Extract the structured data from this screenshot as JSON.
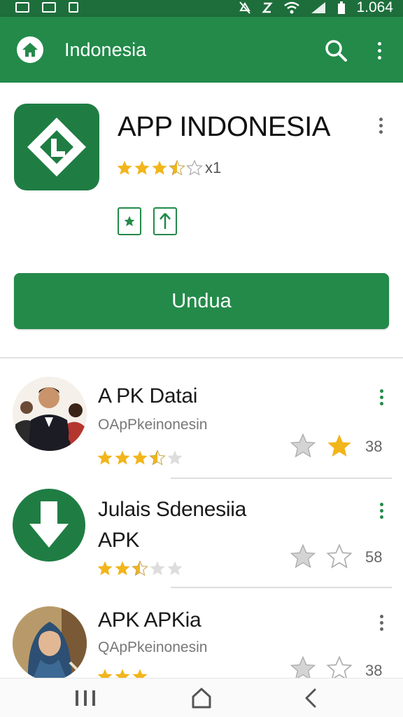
{
  "status_bar": {
    "time": "1.064",
    "icons": [
      "notification-icon",
      "image-icon",
      "phone-icon",
      "no-sound-icon",
      "no-signal-icon",
      "wifi-icon",
      "signal-icon",
      "battery-icon"
    ]
  },
  "app_bar": {
    "title": "Indonesia",
    "icons": [
      "home-icon",
      "search-icon",
      "more-vert-icon"
    ]
  },
  "featured_app": {
    "title": "APP INDONESIA",
    "rating": 3.5,
    "rating_count": "x1",
    "badges": [
      "editors-choice-icon",
      "upload-icon"
    ],
    "install_label": "Undua",
    "brand_color": "#238a4a"
  },
  "list": [
    {
      "name": "A PK Datai",
      "subtitle": "OApPkeinonesin",
      "rating": 3.5,
      "side_stars": [
        "gray",
        "gold"
      ],
      "count": "38",
      "thumb": "people-photo",
      "menu_color": "#238a4a"
    },
    {
      "name": "Julais Sdenesiia",
      "name_line2": "APK",
      "subtitle": "",
      "rating": 2.5,
      "side_stars": [
        "gray",
        "outline"
      ],
      "count": "58",
      "thumb": "download-icon",
      "menu_color": "#238a4a"
    },
    {
      "name": "APK APKia",
      "subtitle": "QApPkeinonesin",
      "rating": 3,
      "side_stars": [
        "gray",
        "outline"
      ],
      "count": "38",
      "thumb": "woman-photo",
      "menu_color": "#666666"
    }
  ],
  "nav_bar": {
    "icons": [
      "recents-icon",
      "home-outline-icon",
      "back-icon"
    ]
  }
}
